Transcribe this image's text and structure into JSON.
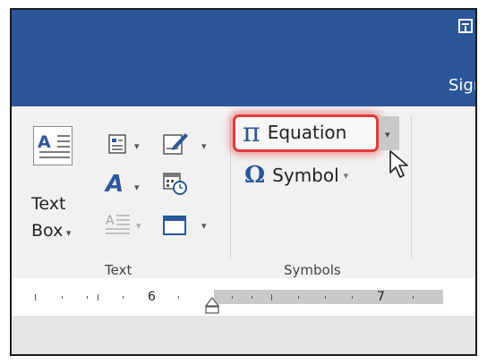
{
  "titlebar": {
    "sign_label": "Sigr",
    "color": "#2b579a",
    "icon": "window-restore-icon"
  },
  "ribbon": {
    "text_group": {
      "label": "Text",
      "text_box": {
        "label_line1": "Text",
        "label_line2": "Box",
        "icon": "text-box-icon"
      },
      "buttons": [
        {
          "icon": "quick-parts-icon",
          "has_dropdown": true
        },
        {
          "icon": "signature-line-icon",
          "has_dropdown": true
        },
        {
          "icon": "wordart-icon",
          "has_dropdown": true
        },
        {
          "icon": "date-time-icon",
          "has_dropdown": false
        },
        {
          "icon": "drop-cap-icon",
          "has_dropdown": true
        },
        {
          "icon": "object-icon",
          "has_dropdown": true
        }
      ]
    },
    "symbols_group": {
      "label": "Symbols",
      "equation": {
        "glyph": "π",
        "label": "Equation",
        "highlight_color": "#e03c3c"
      },
      "symbol": {
        "glyph": "Ω",
        "label": "Symbol"
      }
    }
  },
  "ruler": {
    "numbers": [
      "6",
      "7"
    ]
  }
}
